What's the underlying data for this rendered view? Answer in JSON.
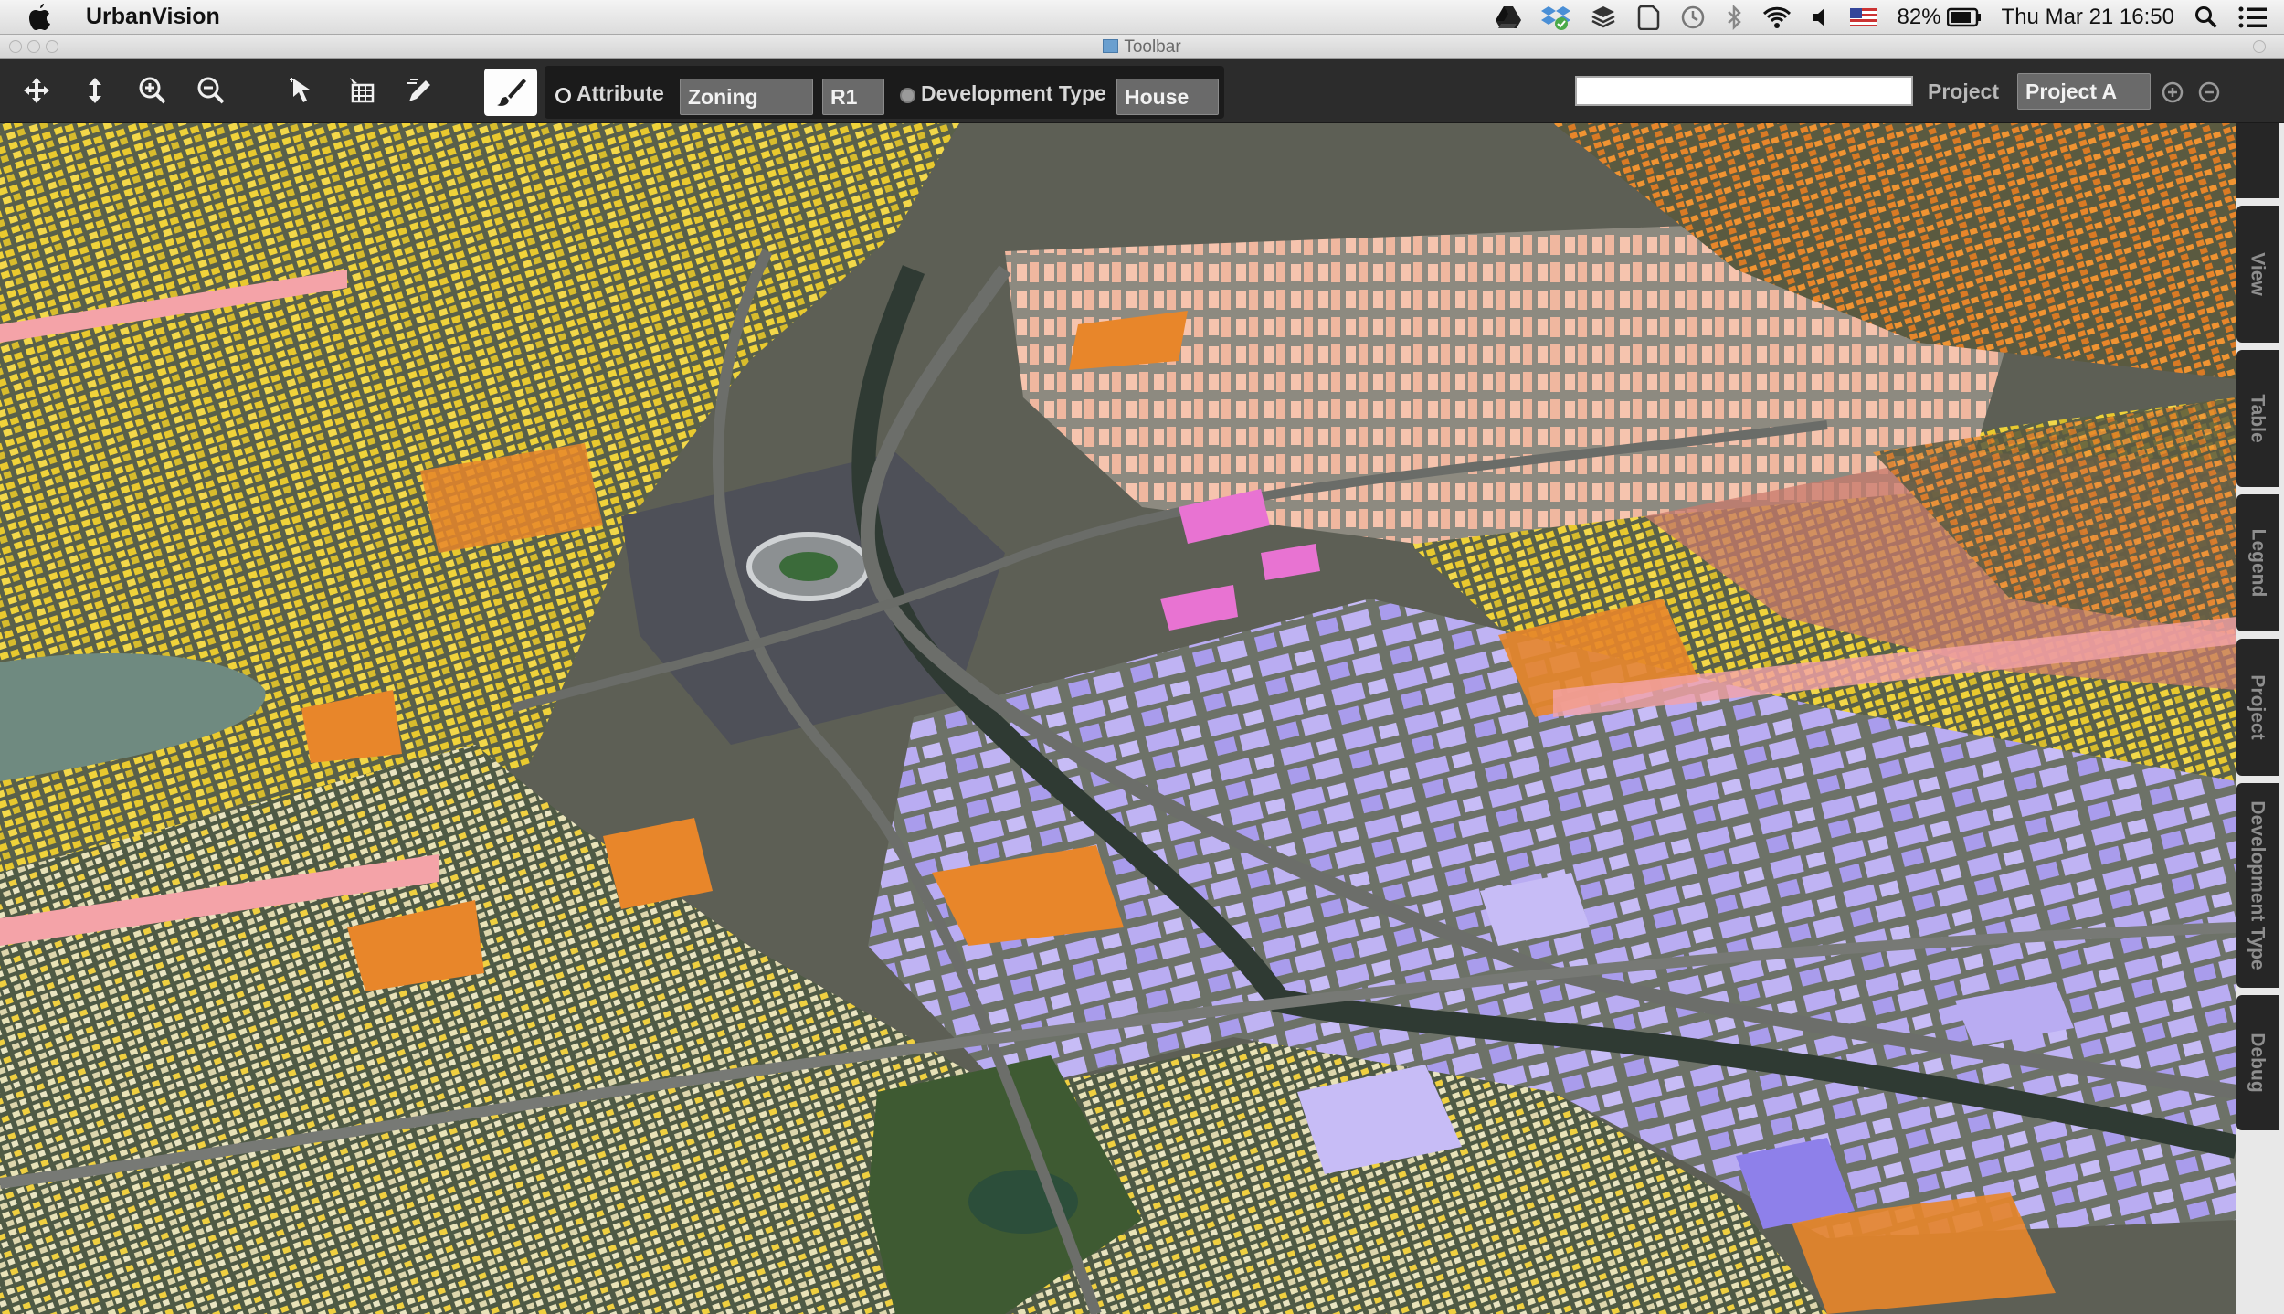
{
  "menubar": {
    "app_name": "UrbanVision",
    "battery_percent": "82%",
    "clock": "Thu Mar 21  16:50",
    "icons": [
      "google-drive-icon",
      "dropbox-icon",
      "layers-icon",
      "evernote-icon",
      "time-machine-icon",
      "bluetooth-icon",
      "wifi-icon",
      "volume-icon",
      "us-flag-icon",
      "battery-icon",
      "spotlight-search-icon",
      "notification-center-icon"
    ]
  },
  "window": {
    "title": "Toolbar"
  },
  "toolbar": {
    "tools": [
      "pan-icon",
      "vertical-move-icon",
      "zoom-in-icon",
      "zoom-out-icon",
      "select-icon",
      "grid-select-icon",
      "edit-icon"
    ],
    "paint_tool": "paintbrush-icon",
    "attribute_label": "Attribute",
    "attribute_value": "Zoning",
    "zone_value": "R1",
    "devtype_label": "Development Type",
    "devtype_value": "House",
    "search_value": "",
    "project_label": "Project",
    "project_value": "Project A"
  },
  "sidebar": {
    "tabs": [
      "View",
      "Table",
      "Legend",
      "Project",
      "Development Type",
      "Debug"
    ]
  },
  "map": {
    "view": "3D aerial city view with buildings colored by development type",
    "colors": {
      "residential_yellow": "#f0d33a",
      "orange": "#e8862a",
      "pink": "#f3b0a0",
      "red": "#d96a6a",
      "purple": "#b6a8f0",
      "magenta": "#e873d2"
    }
  }
}
